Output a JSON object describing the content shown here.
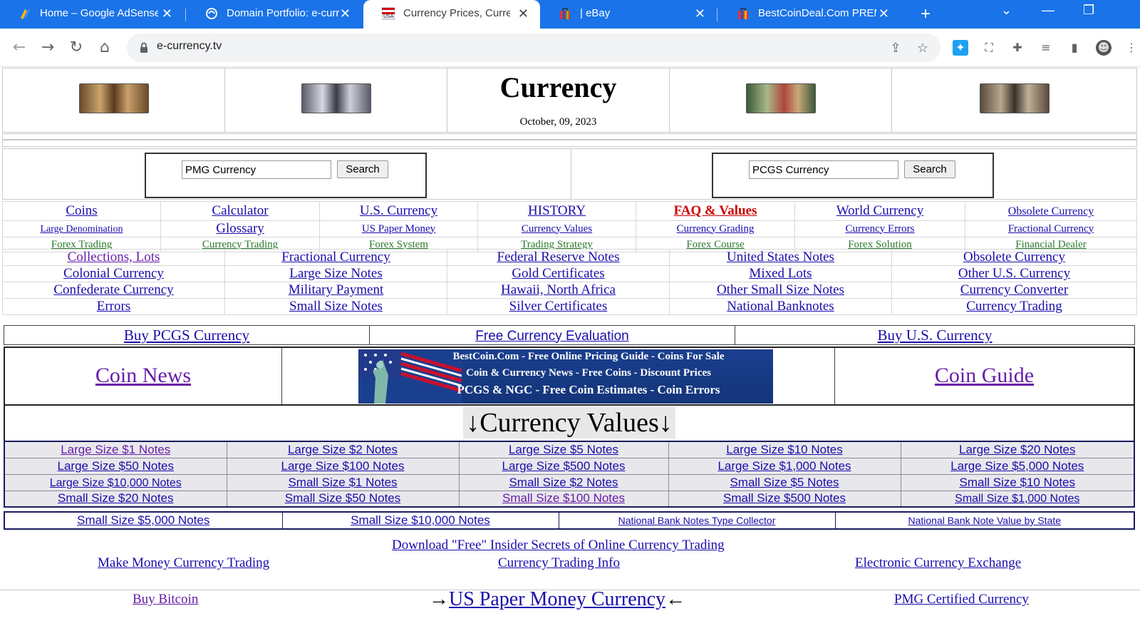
{
  "browser": {
    "tabs": [
      {
        "title": "Home – Google AdSense",
        "icon": "adsense-icon",
        "active": false
      },
      {
        "title": "Domain Portfolio: e-curr",
        "icon": "domain-portfolio-icon",
        "active": false
      },
      {
        "title": "Currency Prices, Currency",
        "icon": "usa-flag-icon",
        "active": true
      },
      {
        "title": "| eBay",
        "icon": "ebay-bag-icon",
        "active": false
      },
      {
        "title": "BestCoinDeal.Com PREM",
        "icon": "bag-icon",
        "active": false
      }
    ],
    "new_tab": "+",
    "url": "e-currency.tv"
  },
  "header": {
    "title": "Currency",
    "date": "October, 09, 2023"
  },
  "search": {
    "left": {
      "value": "PMG Currency",
      "button": "Search"
    },
    "right": {
      "value": "PCGS Currency",
      "button": "Search"
    }
  },
  "nav7": {
    "row1": [
      "Coins",
      "Calculator",
      "U.S. Currency",
      "HISTORY",
      "FAQ & Values",
      "World Currency",
      "Obsolete Currency"
    ],
    "row2": [
      "Large Denomination",
      "Glossary",
      "US Paper Money",
      "Currency Values",
      "Currency Grading",
      "Currency Errors",
      "Fractional Currency"
    ],
    "row3": [
      "Forex Trading",
      "Currency Trading",
      "Forex System",
      "Trading Strategy",
      "Forex Course",
      "Forex Solution",
      "Financial Dealer"
    ]
  },
  "nav5": [
    [
      "Collections, Lots",
      "Fractional Currency",
      "Federal Reserve Notes",
      "United States Notes",
      "Obsolete Currency"
    ],
    [
      "Colonial Currency",
      "Large Size Notes",
      "Gold Certificates",
      "Mixed Lots",
      "Other U.S. Currency"
    ],
    [
      "Confederate Currency",
      "Military Payment",
      "Hawaii, North Africa",
      "Other Small Size Notes",
      "Currency Converter"
    ],
    [
      "Errors",
      "Small Size Notes",
      "Silver Certificates",
      "National Banknotes",
      "Currency Trading"
    ]
  ],
  "buy": [
    "Buy PCGS Currency",
    "Free Currency Evaluation",
    "Buy U.S. Currency"
  ],
  "news": {
    "left": "Coin News",
    "right": "Coin Guide",
    "banner": [
      "BestCoin.Com  - Free Online Pricing Guide -  Coins For Sale",
      "Coin & Currency News - Free Coins - Discount Prices",
      "PCGS & NGC - Free Coin Estimates - Coin Errors"
    ]
  },
  "currency_values": {
    "title": "↓Currency Values↓",
    "grid": [
      [
        "Large Size $1 Notes",
        "Large Size $2 Notes",
        "Large Size $5 Notes",
        "Large Size $10 Notes",
        "Large Size $20 Notes"
      ],
      [
        "Large Size $50 Notes",
        "Large Size $100 Notes",
        "Large Size $500 Notes",
        "Large Size $1,000 Notes",
        "Large Size $5,000 Notes"
      ],
      [
        "Large Size $10,000 Notes",
        "Small Size $1 Notes",
        "Small Size $2 Notes",
        "Small Size $5 Notes",
        "Small Size $10 Notes"
      ],
      [
        "Small Size $20 Notes",
        "Small Size $50 Notes",
        "Small Size $100 Notes",
        "Small Size $500 Notes",
        "Small Size $1,000 Notes"
      ]
    ],
    "last_row": [
      "Small Size $5,000 Notes",
      "Small Size $10,000 Notes",
      "National Bank Notes Type Collector",
      "National Bank Note Value by State"
    ]
  },
  "footer": {
    "download": "Download \"Free\" Insider Secrets of Online Currency Trading",
    "make_money": "Make Money Currency Trading",
    "trading_info": "Currency Trading Info",
    "exchange": "Electronic Currency Exchange",
    "bitcoin": "Buy Bitcoin",
    "us_paper_arrow_left": "→",
    "us_paper": "US Paper Money Currency",
    "us_paper_arrow_right": "←",
    "pmg": "PMG Certified Currency"
  },
  "colors": {
    "chrome_blue": "#1a73e8",
    "link": "#1a0dab",
    "visited": "#681da8",
    "faq_red": "#cc0000",
    "forex_green": "#2a7a2a",
    "banner_blue": "#1b3f8f"
  }
}
